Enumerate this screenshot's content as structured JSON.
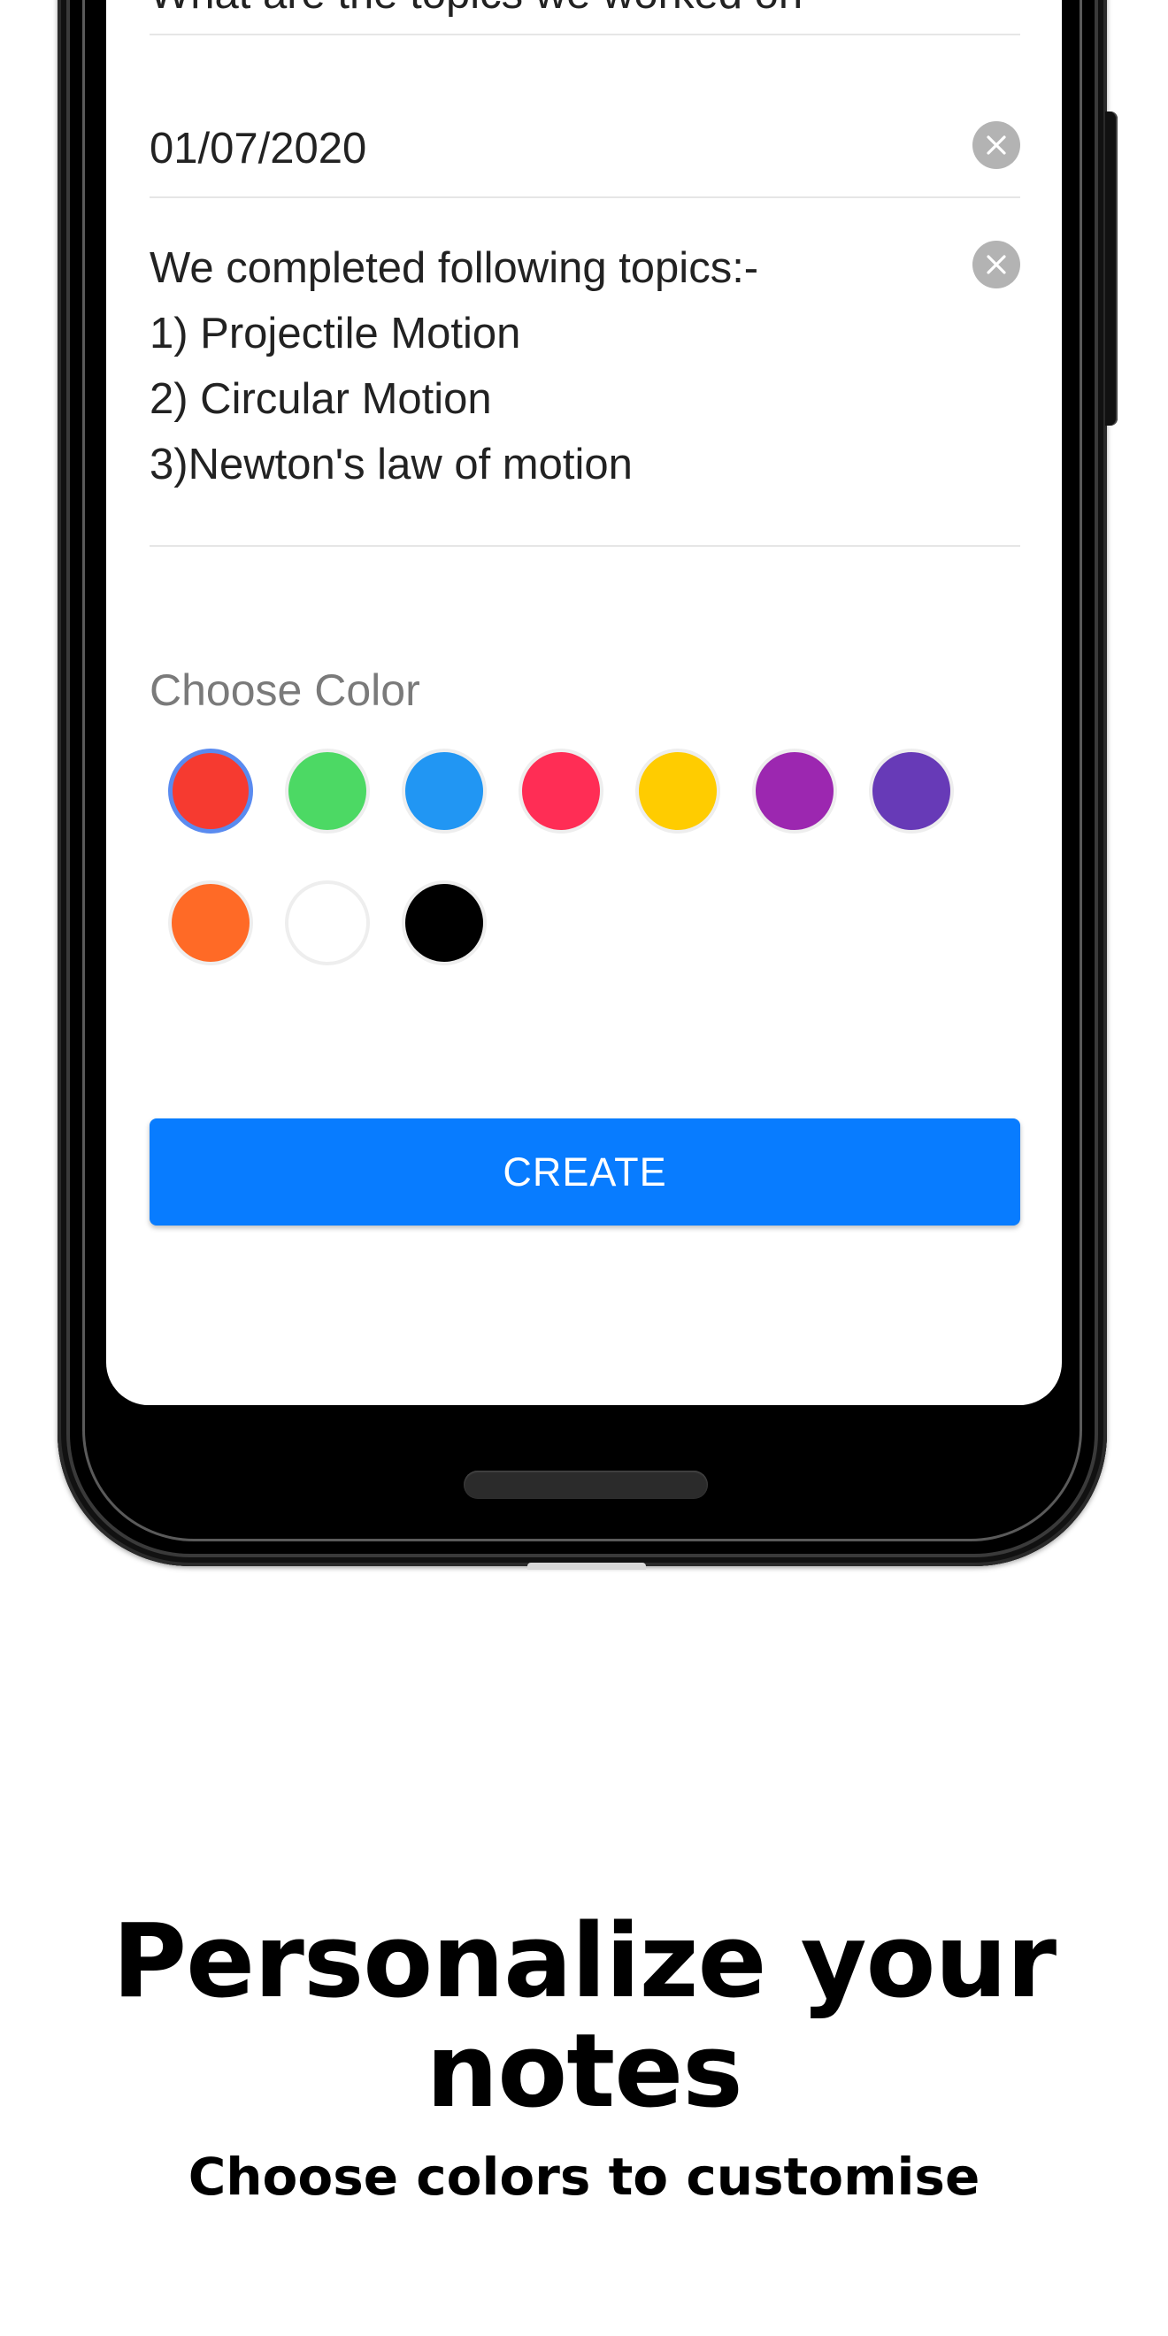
{
  "note_form": {
    "title_field": {
      "value": "What are the topics we worked on"
    },
    "date_field": {
      "value": "01/07/2020"
    },
    "body_field": {
      "value": "We completed following topics:-\n1) Projectile Motion\n2) Circular Motion\n3)Newton's law of motion"
    },
    "color_label": "Choose Color",
    "colors": [
      {
        "name": "red",
        "hex": "#f63a30",
        "selected": true
      },
      {
        "name": "green",
        "hex": "#4cd964"
      },
      {
        "name": "blue",
        "hex": "#2196f3"
      },
      {
        "name": "pink",
        "hex": "#ff2d55"
      },
      {
        "name": "yellow",
        "hex": "#ffcc00"
      },
      {
        "name": "purple",
        "hex": "#9c27b0"
      },
      {
        "name": "deep-purple",
        "hex": "#673ab7"
      },
      {
        "name": "orange",
        "hex": "#ff6a26"
      },
      {
        "name": "white",
        "hex": "#ffffff"
      },
      {
        "name": "black",
        "hex": "#000000"
      }
    ],
    "create_button_label": "CREATE",
    "accent_color": "#087cff"
  },
  "promo": {
    "headline": "Personalize your notes",
    "subheadline": "Choose colors to customise"
  }
}
